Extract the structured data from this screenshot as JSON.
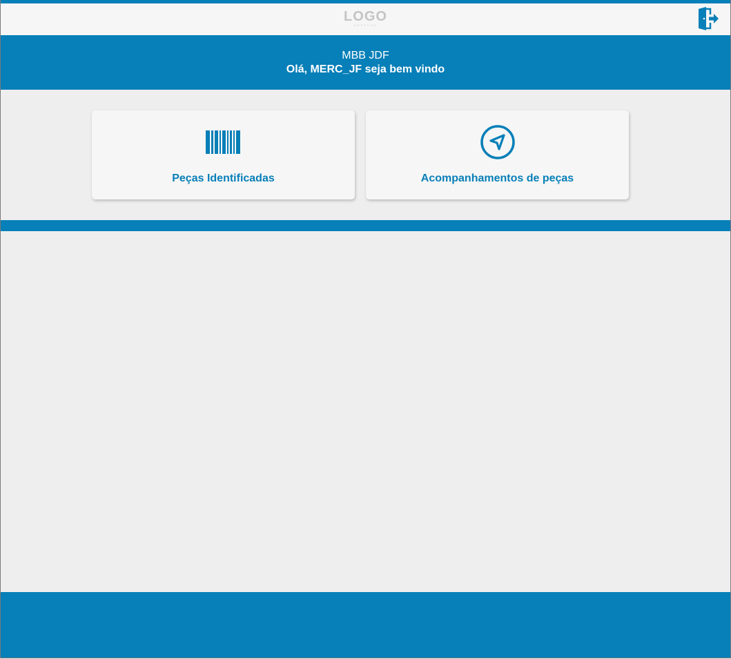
{
  "colors": {
    "brand": "#077fb8",
    "background": "#eeeeee",
    "card": "#f6f6f6",
    "logo": "#c4c4c4"
  },
  "header": {
    "logo_text": "LOGO",
    "logo_subtext": "EMPRESA",
    "logout_icon": "logout-door-icon"
  },
  "banner": {
    "org_name": "MBB JDF",
    "welcome": "Olá, MERC_JF seja bem vindo"
  },
  "cards": [
    {
      "label": "Peças Identificadas",
      "icon": "barcode-icon"
    },
    {
      "label": "Acompanhamentos de peças",
      "icon": "navigation-arrow-icon"
    }
  ]
}
